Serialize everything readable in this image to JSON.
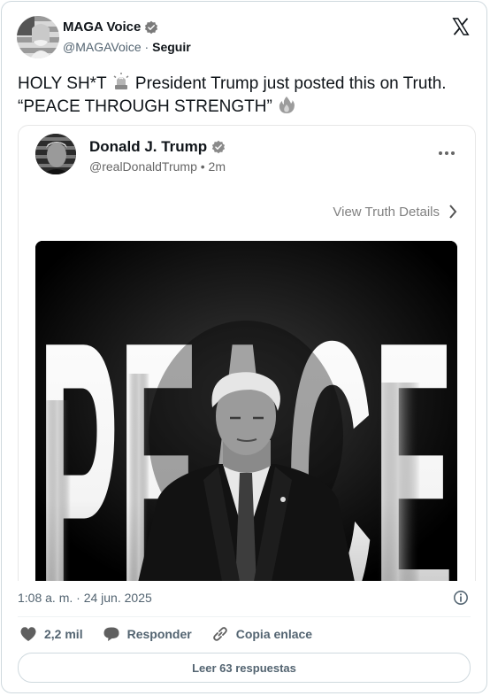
{
  "author": {
    "name": "MAGA Voice",
    "handle": "@MAGAVoice",
    "separator": "·",
    "follow_label": "Seguir"
  },
  "tweet": {
    "line1_a": "HOLY SH*T",
    "line1_b": "President Trump just posted this on Truth.",
    "line2": "“PEACE THROUGH STRENGTH”"
  },
  "quote": {
    "name": "Donald J. Trump",
    "handle": "@realDonaldTrump",
    "time": "• 2m",
    "details_label": "View Truth Details",
    "image_text": "PEACE"
  },
  "meta": {
    "timestamp": "1:08 a. m. · 24 jun. 2025"
  },
  "actions": {
    "likes": "2,2 mil",
    "reply_label": "Responder",
    "copy_label": "Copia enlace"
  },
  "replies_button": "Leer 63 respuestas",
  "icons": [
    "verified-icon",
    "x-logo-icon",
    "siren-emoji-icon",
    "fire-emoji-icon",
    "more-icon",
    "chevron-right-icon",
    "info-icon",
    "heart-icon",
    "reply-icon",
    "link-icon"
  ]
}
